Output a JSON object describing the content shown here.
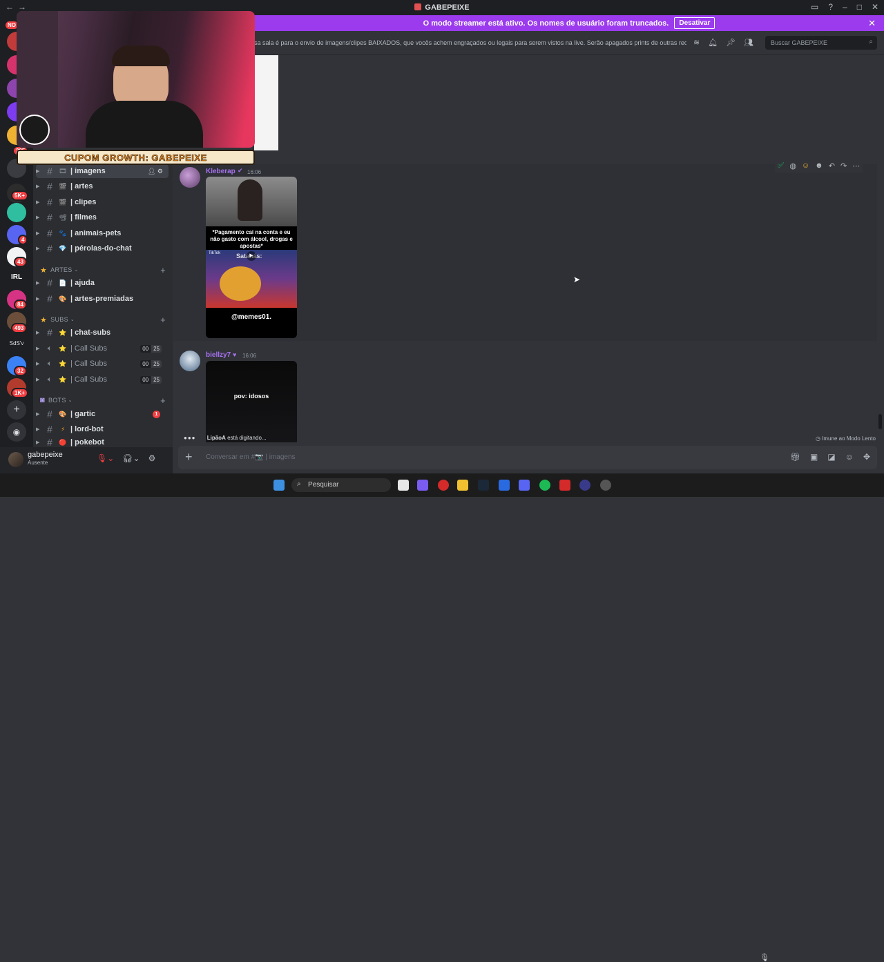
{
  "window": {
    "title": "GABEPEIXE"
  },
  "banner": {
    "text": "O modo streamer está ativo. Os nomes de usuário foram truncados.",
    "button": "Desativar"
  },
  "header": {
    "topic": "sa sala é para o envio de imagens/clipes BAIXADOS, que vocês achem engraçados ou legais para serem vistos na live. Serão apagados prints de outras rede...",
    "search_placeholder": "Buscar GABEPEIXE"
  },
  "servers": {
    "badges": [
      "NO",
      "295",
      "5K+",
      "4",
      "43",
      "84",
      "493",
      "32",
      "1K+"
    ],
    "labels": [
      "IRL",
      "SdS'v"
    ]
  },
  "overlay": {
    "coupon": "CUPOM GROWTH: GABEPEIXE"
  },
  "sidebar": {
    "channels": [
      {
        "name": "| imagens",
        "emoji": "🎞"
      },
      {
        "name": "| artes",
        "emoji": "🎬"
      },
      {
        "name": "| clipes",
        "emoji": "🎬"
      },
      {
        "name": "| filmes",
        "emoji": "📽"
      },
      {
        "name": "| animais-pets",
        "emoji": "🐾"
      },
      {
        "name": "| pérolas-do-chat",
        "emoji": "💎"
      }
    ],
    "categories": {
      "artes": "ARTES",
      "subs": "SUBS",
      "bots": "BOTS"
    },
    "artes_channels": [
      {
        "name": "| ajuda",
        "emoji": "📄"
      },
      {
        "name": "| artes-premiadas",
        "emoji": "🎨"
      }
    ],
    "subs_channels": [
      {
        "name": "| chat-subs",
        "emoji": "⭐"
      },
      {
        "name": "| Call Subs",
        "emoji": "⭐",
        "left": "00",
        "right": "25"
      },
      {
        "name": "| Call Subs",
        "emoji": "⭐",
        "left": "00",
        "right": "25"
      },
      {
        "name": "| Call Subs",
        "emoji": "⭐",
        "left": "00",
        "right": "25"
      }
    ],
    "bots_channels": [
      {
        "name": "| gartic",
        "emoji": "🎨",
        "unread": "1"
      },
      {
        "name": "| lord-bot",
        "emoji": "⚡"
      },
      {
        "name": "| pokebot",
        "emoji": "🔴"
      }
    ]
  },
  "user": {
    "name": "gabepeixe",
    "status": "Ausente"
  },
  "messages": [
    {
      "author": "Kleberap",
      "time": "16:06",
      "media_caption": "*Pagamento cai na conta e eu não gasto com álcool, drogas e apostas*",
      "media_sub": "Satanás:",
      "media_tag": "TikTok",
      "media_footer": "@memes01."
    },
    {
      "author": "biellzy7",
      "time": "16:06",
      "media_caption": "pov: idosos"
    }
  ],
  "typing": {
    "user": "LipãoA",
    "text": "está digitando..."
  },
  "slowmode": "Imune ao Modo Lento",
  "composer": {
    "placeholder": "Conversar em #📷 | imagens"
  },
  "taskbar": {
    "search": "Pesquisar"
  },
  "colors": {
    "banner": "#9b3bed",
    "accent_name": "#a672f0",
    "unread": "#f23f43",
    "bg": "#313338"
  }
}
